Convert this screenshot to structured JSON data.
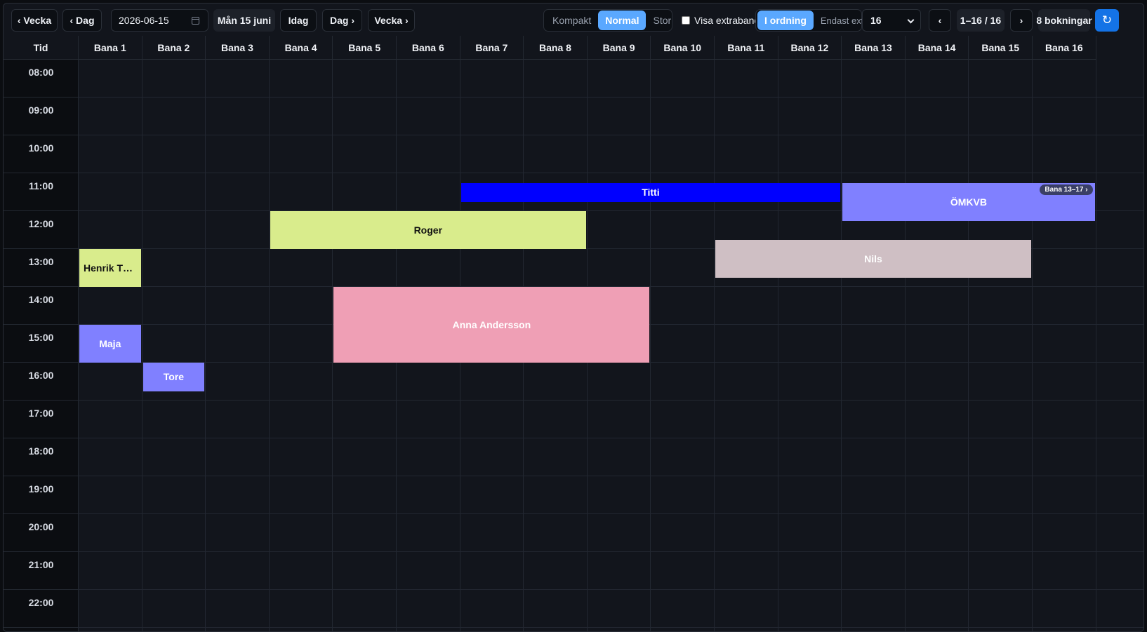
{
  "toolbar": {
    "prev_week": "‹ Vecka",
    "prev_day": "‹ Dag",
    "date_value": "2026-06-15",
    "current_date_label": "Mån 15 juni",
    "today": "Idag",
    "next_day": "Dag ›",
    "next_week": "Vecka ›",
    "density": {
      "options": [
        "Kompakt",
        "Normal",
        "Stor"
      ],
      "selected": "Normal"
    },
    "show_extra_label": "Visa extrabanor",
    "show_extra_checked": false,
    "lane_mode": {
      "options": [
        "I ordning",
        "Endast extra"
      ],
      "selected": "I ordning"
    },
    "lanes_per_page": "16",
    "page_prev": "‹",
    "page_range": "1–16 / 16",
    "page_next": "›",
    "booking_count": "8 bokningar",
    "refresh_icon": "↻"
  },
  "grid": {
    "time_header": "Tid",
    "lanes": [
      "Bana 1",
      "Bana 2",
      "Bana 3",
      "Bana 4",
      "Bana 5",
      "Bana 6",
      "Bana 7",
      "Bana 8",
      "Bana 9",
      "Bana 10",
      "Bana 11",
      "Bana 12",
      "Bana 13",
      "Bana 14",
      "Bana 15",
      "Bana 16"
    ],
    "hours": [
      "08:00",
      "09:00",
      "10:00",
      "11:00",
      "12:00",
      "13:00",
      "14:00",
      "15:00",
      "16:00",
      "17:00",
      "18:00",
      "19:00",
      "20:00",
      "21:00",
      "22:00"
    ]
  },
  "bookings": [
    {
      "name": "Titti",
      "lane_start": 7,
      "lane_end": 12,
      "start": "11:15",
      "end": "11:45",
      "color": "#0000ff",
      "text_color": "#ffffff"
    },
    {
      "name": "ÖMKVB",
      "lane_start": 13,
      "lane_end": 16,
      "start": "11:15",
      "end": "12:15",
      "color": "#8080ff",
      "text_color": "#ffffff",
      "badge": "Bana 13–17 ›"
    },
    {
      "name": "Roger",
      "lane_start": 4,
      "lane_end": 8,
      "start": "12:00",
      "end": "13:00",
      "color": "#d9ec8c",
      "text_color": "#111111"
    },
    {
      "name": "Nils",
      "lane_start": 11,
      "lane_end": 15,
      "start": "12:45",
      "end": "13:45",
      "color": "#cfbfc4",
      "text_color": "#ffffff"
    },
    {
      "name": "Henrik Tö...",
      "lane_start": 1,
      "lane_end": 1,
      "start": "13:00",
      "end": "14:00",
      "color": "#d9ec8c",
      "text_color": "#111111"
    },
    {
      "name": "Anna Andersson",
      "lane_start": 5,
      "lane_end": 9,
      "start": "14:00",
      "end": "16:00",
      "color": "#ef9fb5",
      "text_color": "#ffffff"
    },
    {
      "name": "Maja",
      "lane_start": 1,
      "lane_end": 1,
      "start": "15:00",
      "end": "16:00",
      "color": "#8080ff",
      "text_color": "#ffffff"
    },
    {
      "name": "Tore",
      "lane_start": 2,
      "lane_end": 2,
      "start": "16:00",
      "end": "16:45",
      "color": "#8080ff",
      "text_color": "#ffffff"
    }
  ]
}
